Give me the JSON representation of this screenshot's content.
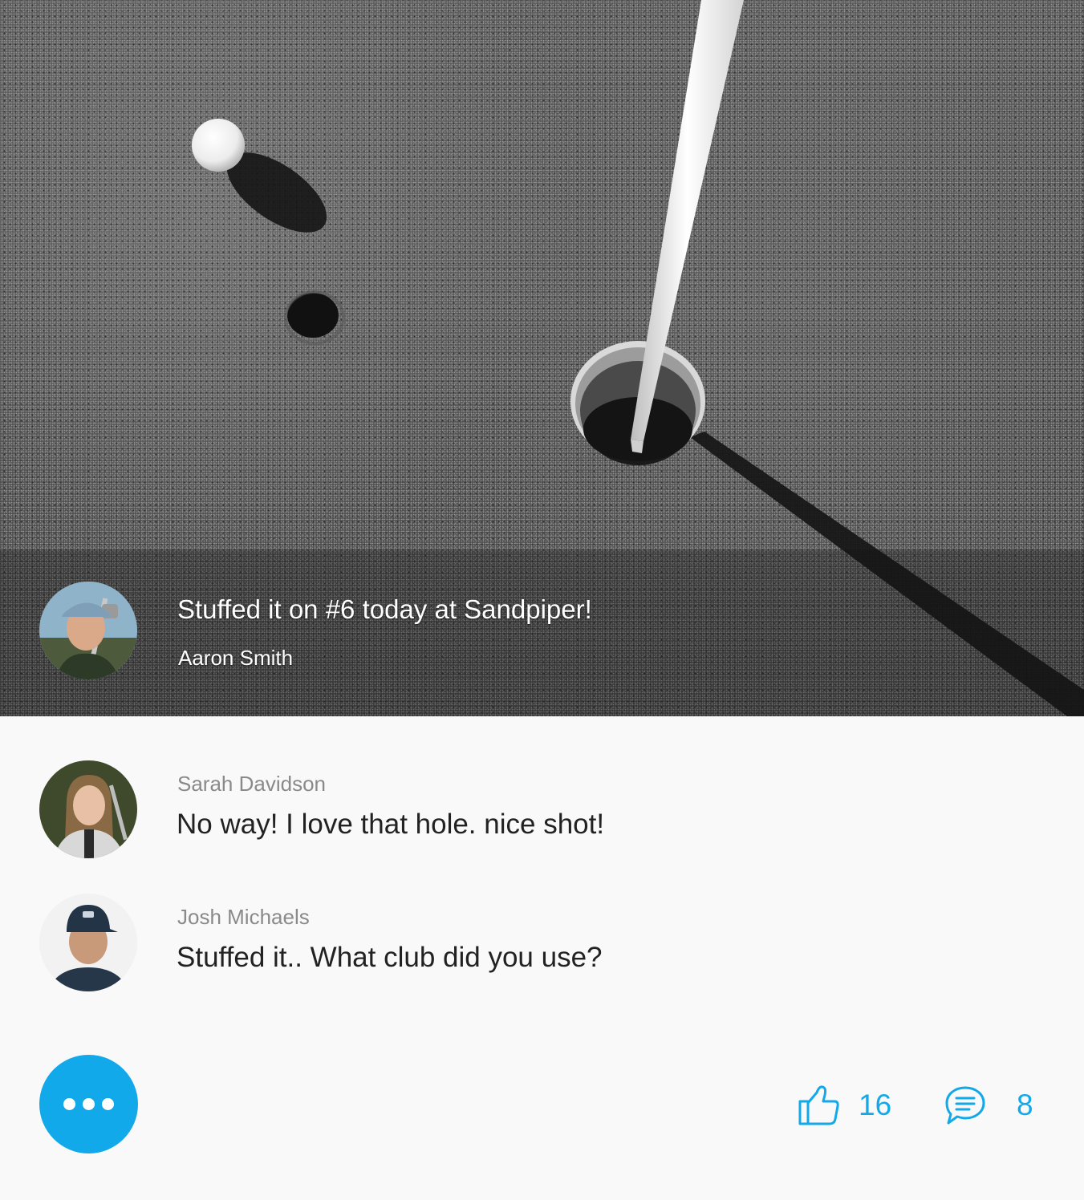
{
  "post": {
    "title": "Stuffed it on #6 today at Sandpiper!",
    "author": "Aaron Smith"
  },
  "comments": [
    {
      "author": "Sarah Davidson",
      "text": "No way! I love that hole. nice shot!"
    },
    {
      "author": "Josh Michaels",
      "text": "Stuffed it.. What club did you use?"
    }
  ],
  "actions": {
    "likes": "16",
    "comments": "8"
  },
  "colors": {
    "accent": "#12a9ea",
    "background": "#f9f9f9",
    "comment_text": "#222222",
    "comment_name": "#8a8a8a"
  },
  "icons": {
    "more": "ellipsis-icon",
    "like": "thumbs-up-icon",
    "comment": "speech-bubble-icon"
  }
}
